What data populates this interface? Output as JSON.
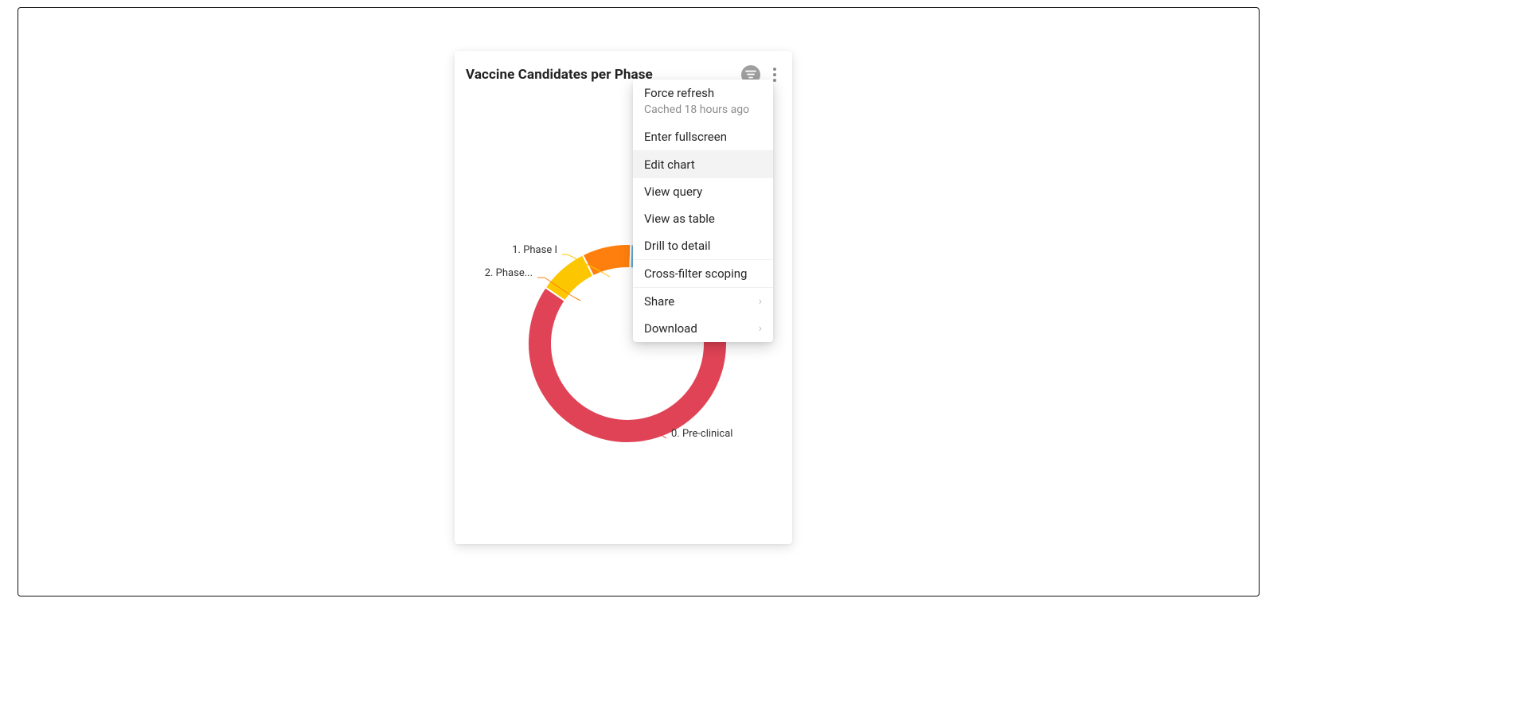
{
  "card": {
    "title": "Vaccine Candidates per Phase"
  },
  "chart_data": {
    "type": "pie",
    "title": "Vaccine Candidates per Phase",
    "donut": true,
    "series": [
      {
        "name": "0. Pre-clinical",
        "value": 79,
        "color": "#e04355"
      },
      {
        "name": "1. Phase I",
        "value": 8,
        "color": "#fcc700"
      },
      {
        "name": "2. Phase...",
        "value": 8,
        "color": "#ff7f0e"
      },
      {
        "name": "",
        "value": 5,
        "color": "#6cb0d8"
      }
    ],
    "labels_visible": [
      "0. Pre-clinical",
      "1. Phase I",
      "2. Phase..."
    ]
  },
  "labels": {
    "preclinical": "0. Pre-clinical",
    "phase1": "1. Phase I",
    "phase2": "2. Phase..."
  },
  "menu": {
    "force_refresh": "Force refresh",
    "cached": "Cached 18 hours ago",
    "enter_fullscreen": "Enter fullscreen",
    "edit_chart": "Edit chart",
    "view_query": "View query",
    "view_as_table": "View as table",
    "drill_to_detail": "Drill to detail",
    "cross_filter_scoping": "Cross-filter scoping",
    "share": "Share",
    "download": "Download"
  }
}
